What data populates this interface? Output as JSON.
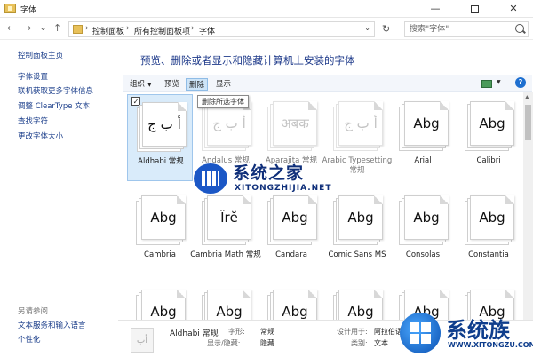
{
  "window": {
    "title": "字体",
    "minimize_glyph": "—",
    "close_glyph": "✕"
  },
  "nav": {
    "back": "←",
    "forward": "→",
    "recent": "⌄",
    "up": "↑",
    "refresh": "↻"
  },
  "address": {
    "crumbs": [
      "控制面板",
      "所有控制面板项",
      "字体"
    ],
    "separator": "›",
    "dropdown": "⌄"
  },
  "search": {
    "placeholder": "搜索\"字体\""
  },
  "sidebar": {
    "items": [
      {
        "label": "控制面板主页"
      },
      {
        "label": "字体设置"
      },
      {
        "label": "联机获取更多字体信息"
      },
      {
        "label": "调整 ClearType 文本"
      },
      {
        "label": "查找字符"
      },
      {
        "label": "更改字体大小"
      }
    ],
    "see_also_label": "另请参阅",
    "see_also": [
      {
        "label": "文本服务和输入语言"
      },
      {
        "label": "个性化"
      }
    ]
  },
  "main": {
    "heading": "预览、删除或者显示和隐藏计算机上安装的字体"
  },
  "toolbar": {
    "organize": "组织",
    "organize_arrow": "▼",
    "preview": "预览",
    "delete": "删除",
    "show": "显示",
    "view_dropdown": "▼",
    "help": "?"
  },
  "tooltip": "删除所选字体",
  "fonts": [
    {
      "name": "Aldhabi 常规",
      "sample": "أ ب ج",
      "state": "selected",
      "checked": "✓"
    },
    {
      "name": "Andalus 常规",
      "sample": "أ ب ج",
      "state": "hidden"
    },
    {
      "name": "Aparajita 常规",
      "sample": "अबक",
      "state": "hidden"
    },
    {
      "name": "Arabic Typesetting 常规",
      "sample": "أ ب ج",
      "state": "hidden"
    },
    {
      "name": "Arial",
      "sample": "Abg",
      "state": "normal"
    },
    {
      "name": "Calibri",
      "sample": "Abg",
      "state": "normal"
    },
    {
      "name": "Cambria",
      "sample": "Abg",
      "state": "normal"
    },
    {
      "name": "Cambria Math 常规",
      "sample": "Ïrĕ",
      "state": "normal"
    },
    {
      "name": "Candara",
      "sample": "Abg",
      "state": "normal"
    },
    {
      "name": "Comic Sans MS",
      "sample": "Abg",
      "state": "normal"
    },
    {
      "name": "Consolas",
      "sample": "Abg",
      "state": "normal"
    },
    {
      "name": "Constantia",
      "sample": "Abg",
      "state": "normal"
    },
    {
      "name": "",
      "sample": "Abg",
      "state": "normal"
    },
    {
      "name": "",
      "sample": "Abg",
      "state": "normal"
    },
    {
      "name": "",
      "sample": "Abg",
      "state": "normal"
    },
    {
      "name": "",
      "sample": "Abg",
      "state": "normal"
    },
    {
      "name": "",
      "sample": "Abg",
      "state": "normal"
    },
    {
      "name": "",
      "sample": "Abg",
      "state": "normal"
    }
  ],
  "details": {
    "name": "Aldhabi 常规",
    "thumb": "أب",
    "style_label": "字形:",
    "style_value": "常规",
    "visibility_label": "显示/隐藏:",
    "visibility_value": "隐藏",
    "designed_for_label": "设计用于:",
    "designed_for_value": "阿拉伯语",
    "category_label": "类别:",
    "category_value": "文本"
  },
  "watermark": {
    "site_title": "系统之家",
    "site_url": "XITONGZHIJIA.NET",
    "corner_title": "系统族",
    "corner_url": "WWW.XITONGZU.COM"
  },
  "colors": {
    "link": "#1a3d8a",
    "heading": "#1e3a8a",
    "selection": "#d9ebfa",
    "toolbar_active": "#cde4f7"
  }
}
